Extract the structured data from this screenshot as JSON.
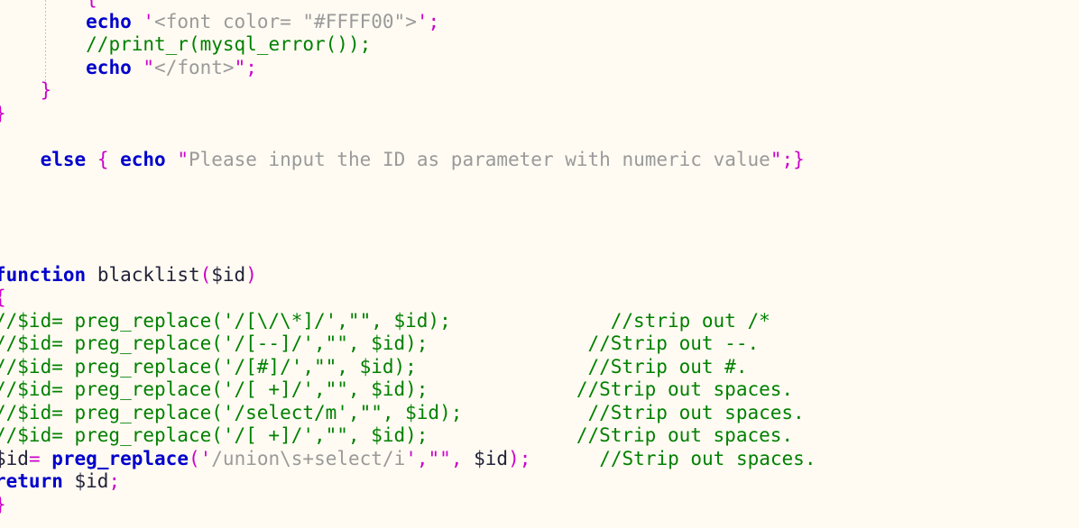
{
  "editor": {
    "language": "PHP",
    "background_color": "#FFFBF2",
    "colors": {
      "keyword": "#0000CC",
      "comment": "#008000",
      "string": "#9A9A9A",
      "punctuation": "#CC00CC",
      "identifier": "#22223A",
      "indent_guide": "#C9C4B8"
    },
    "indent_guide_visible": true,
    "horizontal_scroll_clipped_left": true
  },
  "code": {
    "lines": [
      {
        "id": "line-1",
        "tokens": [
          {
            "t": "punc",
            "s": "        {"
          }
        ]
      },
      {
        "id": "line-2",
        "tokens": [
          {
            "t": "plain",
            "s": "        "
          },
          {
            "t": "kw",
            "s": "echo"
          },
          {
            "t": "plain",
            "s": " "
          },
          {
            "t": "punc",
            "s": "'"
          },
          {
            "t": "str",
            "s": "<font color= \"#FFFF00\">"
          },
          {
            "t": "punc",
            "s": "'"
          },
          {
            "t": "punc",
            "s": ";"
          }
        ]
      },
      {
        "id": "line-3",
        "tokens": [
          {
            "t": "plain",
            "s": "        "
          },
          {
            "t": "cmt",
            "s": "//print_r(mysql_error());"
          }
        ]
      },
      {
        "id": "line-4",
        "tokens": [
          {
            "t": "plain",
            "s": "        "
          },
          {
            "t": "kw",
            "s": "echo"
          },
          {
            "t": "plain",
            "s": " "
          },
          {
            "t": "punc",
            "s": "\""
          },
          {
            "t": "str",
            "s": "</font>"
          },
          {
            "t": "punc",
            "s": "\""
          },
          {
            "t": "punc",
            "s": ";"
          }
        ]
      },
      {
        "id": "line-5",
        "tokens": [
          {
            "t": "plain",
            "s": "    "
          },
          {
            "t": "punc",
            "s": "}"
          }
        ]
      },
      {
        "id": "line-6",
        "tokens": [
          {
            "t": "punc",
            "s": "}"
          }
        ]
      },
      {
        "id": "line-7",
        "tokens": []
      },
      {
        "id": "line-8",
        "tokens": [
          {
            "t": "plain",
            "s": "    "
          },
          {
            "t": "kw",
            "s": "else"
          },
          {
            "t": "plain",
            "s": " "
          },
          {
            "t": "punc",
            "s": "{"
          },
          {
            "t": "plain",
            "s": " "
          },
          {
            "t": "kw",
            "s": "echo"
          },
          {
            "t": "plain",
            "s": " "
          },
          {
            "t": "punc",
            "s": "\""
          },
          {
            "t": "str",
            "s": "Please input the ID as parameter with numeric value"
          },
          {
            "t": "punc",
            "s": "\""
          },
          {
            "t": "punc",
            "s": ";}"
          }
        ]
      },
      {
        "id": "line-9",
        "tokens": []
      },
      {
        "id": "line-10",
        "tokens": []
      },
      {
        "id": "line-11",
        "tokens": []
      },
      {
        "id": "line-12",
        "tokens": []
      },
      {
        "id": "line-13",
        "tokens": [
          {
            "t": "kw",
            "s": "function"
          },
          {
            "t": "plain",
            "s": " "
          },
          {
            "t": "name",
            "s": "blacklist"
          },
          {
            "t": "punc",
            "s": "("
          },
          {
            "t": "var",
            "s": "$id"
          },
          {
            "t": "punc",
            "s": ")"
          }
        ]
      },
      {
        "id": "line-14",
        "tokens": [
          {
            "t": "punc",
            "s": "{"
          }
        ]
      },
      {
        "id": "line-15",
        "tokens": [
          {
            "t": "cmt",
            "s": "//$id= preg_replace('/[\\/\\*]/',\"\", $id);"
          },
          {
            "t": "plain",
            "s": "              "
          },
          {
            "t": "cmt",
            "s": "//strip out /*"
          }
        ]
      },
      {
        "id": "line-16",
        "tokens": [
          {
            "t": "cmt",
            "s": "//$id= preg_replace('/[--]/',\"\", $id);"
          },
          {
            "t": "plain",
            "s": "              "
          },
          {
            "t": "cmt",
            "s": "//Strip out --."
          }
        ]
      },
      {
        "id": "line-17",
        "tokens": [
          {
            "t": "cmt",
            "s": "//$id= preg_replace('/[#]/',\"\", $id);"
          },
          {
            "t": "plain",
            "s": "               "
          },
          {
            "t": "cmt",
            "s": "//Strip out #."
          }
        ]
      },
      {
        "id": "line-18",
        "tokens": [
          {
            "t": "cmt",
            "s": "//$id= preg_replace('/[ +]/',\"\", $id);"
          },
          {
            "t": "plain",
            "s": "             "
          },
          {
            "t": "cmt",
            "s": "//Strip out spaces."
          }
        ]
      },
      {
        "id": "line-19",
        "tokens": [
          {
            "t": "cmt",
            "s": "//$id= preg_replace('/select/m',\"\", $id);"
          },
          {
            "t": "plain",
            "s": "           "
          },
          {
            "t": "cmt",
            "s": "//Strip out spaces."
          }
        ]
      },
      {
        "id": "line-20",
        "tokens": [
          {
            "t": "cmt",
            "s": "//$id= preg_replace('/[ +]/',\"\", $id);"
          },
          {
            "t": "plain",
            "s": "             "
          },
          {
            "t": "cmt",
            "s": "//Strip out spaces."
          }
        ]
      },
      {
        "id": "line-21",
        "tokens": [
          {
            "t": "var",
            "s": "$id"
          },
          {
            "t": "op",
            "s": "="
          },
          {
            "t": "plain",
            "s": " "
          },
          {
            "t": "fn",
            "s": "preg_replace"
          },
          {
            "t": "punc",
            "s": "("
          },
          {
            "t": "punc",
            "s": "'"
          },
          {
            "t": "str",
            "s": "/union\\s+select/i"
          },
          {
            "t": "punc",
            "s": "'"
          },
          {
            "t": "punc",
            "s": ","
          },
          {
            "t": "punc",
            "s": "\"\""
          },
          {
            "t": "punc",
            "s": ","
          },
          {
            "t": "plain",
            "s": " "
          },
          {
            "t": "var",
            "s": "$id"
          },
          {
            "t": "punc",
            "s": ")"
          },
          {
            "t": "punc",
            "s": ";"
          },
          {
            "t": "plain",
            "s": "      "
          },
          {
            "t": "cmt",
            "s": "//Strip out spaces."
          }
        ]
      },
      {
        "id": "line-22",
        "tokens": [
          {
            "t": "kw",
            "s": "return"
          },
          {
            "t": "plain",
            "s": " "
          },
          {
            "t": "var",
            "s": "$id"
          },
          {
            "t": "punc",
            "s": ";"
          }
        ]
      },
      {
        "id": "line-23",
        "tokens": [
          {
            "t": "punc",
            "s": "}"
          }
        ]
      }
    ]
  }
}
